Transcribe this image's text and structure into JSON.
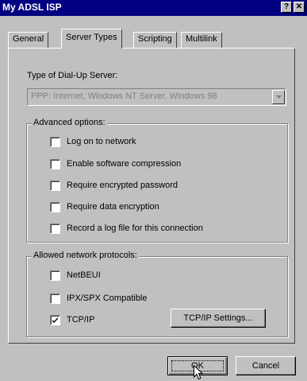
{
  "window": {
    "title": "My ADSL ISP",
    "help_button": "?",
    "close_button": "✕"
  },
  "tabs": [
    {
      "label": "General"
    },
    {
      "label": "Server Types"
    },
    {
      "label": "Scripting"
    },
    {
      "label": "Multilink"
    }
  ],
  "server_type": {
    "label": "Type of Dial-Up Server:",
    "value": "PPP: Internet, Windows NT Server, Windows 98"
  },
  "advanced_options": {
    "title": "Advanced options:",
    "items": [
      {
        "label": "Log on to network",
        "checked": false
      },
      {
        "label": "Enable software compression",
        "checked": false
      },
      {
        "label": "Require encrypted password",
        "checked": false
      },
      {
        "label": "Require data encryption",
        "checked": false
      },
      {
        "label": "Record a log file for this connection",
        "checked": false
      }
    ]
  },
  "protocols": {
    "title": "Allowed network protocols:",
    "items": [
      {
        "label": "NetBEUI",
        "checked": false
      },
      {
        "label": "IPX/SPX Compatible",
        "checked": false
      },
      {
        "label": "TCP/IP",
        "checked": true
      }
    ],
    "tcpip_settings_label": "TCP/IP Settings..."
  },
  "buttons": {
    "ok": "OK",
    "cancel": "Cancel"
  }
}
